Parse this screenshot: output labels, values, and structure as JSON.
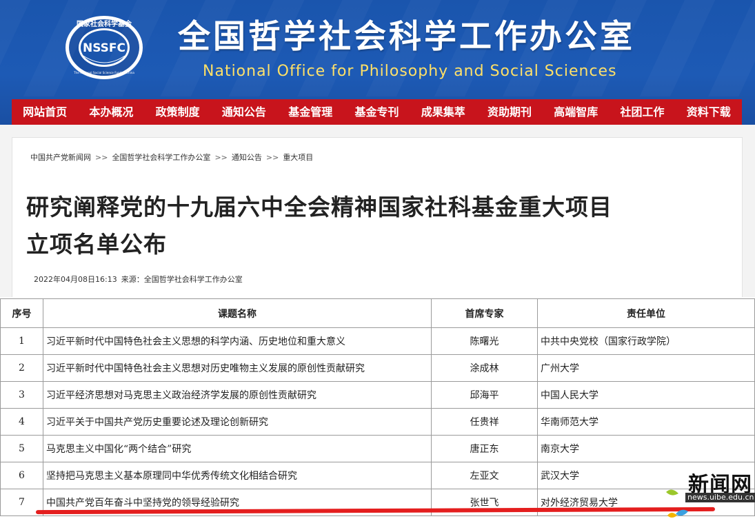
{
  "header": {
    "logo": {
      "ring_text": "国家社会科学基金",
      "abbr": "NSSFC",
      "bottom_text": "The National Social Science Fund of China"
    },
    "title_cn": "全国哲学社会科学工作办公室",
    "title_en": "National Office for Philosophy and Social Sciences",
    "nav": [
      "网站首页",
      "本办概况",
      "政策制度",
      "通知公告",
      "基金管理",
      "基金专刊",
      "成果集萃",
      "资助期刊",
      "高端智库",
      "社团工作",
      "资料下载"
    ]
  },
  "breadcrumb": [
    "中国共产党新闻网",
    "全国哲学社会科学工作办公室",
    "通知公告",
    "重大项目"
  ],
  "breadcrumb_sep": ">>",
  "article": {
    "title_line1": "研究阐释党的十九届六中全会精神国家社科基金重大项目",
    "title_line2": "立项名单公布",
    "datetime": "2022年04月08日16:13",
    "source": "来源：全国哲学社会科学工作办公室"
  },
  "table": {
    "headers": [
      "序号",
      "课题名称",
      "首席专家",
      "责任单位"
    ],
    "rows": [
      [
        "1",
        "习近平新时代中国特色社会主义思想的科学内涵、历史地位和重大意义",
        "陈曙光",
        "中共中央党校（国家行政学院）"
      ],
      [
        "2",
        "习近平新时代中国特色社会主义思想对历史唯物主义发展的原创性贡献研究",
        "涂成林",
        "广州大学"
      ],
      [
        "3",
        "习近平经济思想对马克思主义政治经济学发展的原创性贡献研究",
        "邱海平",
        "中国人民大学"
      ],
      [
        "4",
        "习近平关于中国共产党历史重要论述及理论创新研究",
        "任贵祥",
        "华南师范大学"
      ],
      [
        "5",
        "马克思主义中国化“两个结合”研究",
        "唐正东",
        "南京大学"
      ],
      [
        "6",
        "坚持把马克思主义基本原理同中华优秀传统文化相结合研究",
        "左亚文",
        "武汉大学"
      ],
      [
        "7",
        "中国共产党百年奋斗中坚持党的领导经验研究",
        "张世飞",
        "对外经济贸易大学"
      ]
    ]
  },
  "watermark": {
    "text": "新闻网",
    "url": "news.uibe.edu.cn"
  },
  "colors": {
    "header_blue": "#1d5ab5",
    "nav_red": "#c8141c",
    "title_en_yellow": "#ffe066",
    "highlight_red": "#e41e1e"
  }
}
